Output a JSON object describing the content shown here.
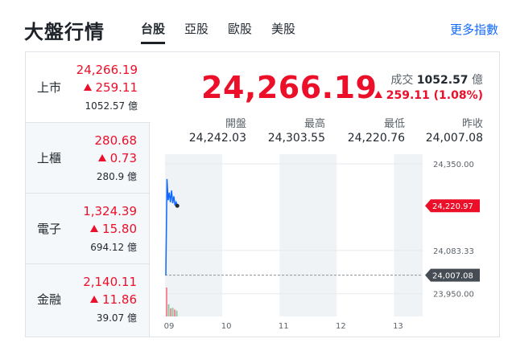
{
  "header": {
    "title": "大盤行情",
    "tabs": [
      {
        "label": "台股",
        "active": true
      },
      {
        "label": "亞股",
        "active": false
      },
      {
        "label": "歐股",
        "active": false
      },
      {
        "label": "美股",
        "active": false
      }
    ],
    "more_link": "更多指數"
  },
  "sidebar": {
    "items": [
      {
        "name": "上市",
        "value": "24,266.19",
        "change": "259.11",
        "volume": "1052.57 億",
        "active": true
      },
      {
        "name": "上櫃",
        "value": "280.68",
        "change": "0.73",
        "volume": "280.9 億",
        "active": false
      },
      {
        "name": "電子",
        "value": "1,324.39",
        "change": "15.80",
        "volume": "694.12 億",
        "active": false
      },
      {
        "name": "金融",
        "value": "2,140.11",
        "change": "11.86",
        "volume": "39.07 億",
        "active": false
      }
    ]
  },
  "main": {
    "price": "24,266.19",
    "volume_label": "成交",
    "volume_value": "1052.57",
    "volume_unit": "億",
    "change": "259.11 (1.08%)",
    "stats": [
      {
        "label": "開盤",
        "value": "24,242.03"
      },
      {
        "label": "最高",
        "value": "24,303.55"
      },
      {
        "label": "最低",
        "value": "24,220.76"
      },
      {
        "label": "昨收",
        "value": "24,007.08"
      }
    ]
  },
  "colors": {
    "up": "#eb0f29",
    "line": "#0f69ff",
    "prev_close": "#454c53",
    "accent_link": "#0f69ff"
  },
  "chart_data": {
    "type": "line",
    "x_ticks": [
      "09",
      "10",
      "11",
      "12",
      "13"
    ],
    "y_ticks": [
      "24,350.00",
      "24,083.33",
      "23,950.00"
    ],
    "ylim": [
      23880,
      24380
    ],
    "current_tag": "24,220.97",
    "current_value": 24220.97,
    "prev_close_tag": "24,007.08",
    "prev_close_value": 24007.08,
    "series": [
      {
        "t": [
          0,
          1,
          2,
          3,
          4,
          5,
          6,
          7,
          8,
          9,
          10
        ],
        "values": [
          24007.08,
          24303.55,
          24238.0,
          24262.0,
          24232.0,
          24268.0,
          24229.0,
          24250.0,
          24222.0,
          24232.0,
          24220.97
        ]
      }
    ],
    "volume_bars": [
      1.0,
      0.42,
      0.28,
      0.3,
      0.24,
      0.2
    ],
    "sessions_minutes": 270
  }
}
